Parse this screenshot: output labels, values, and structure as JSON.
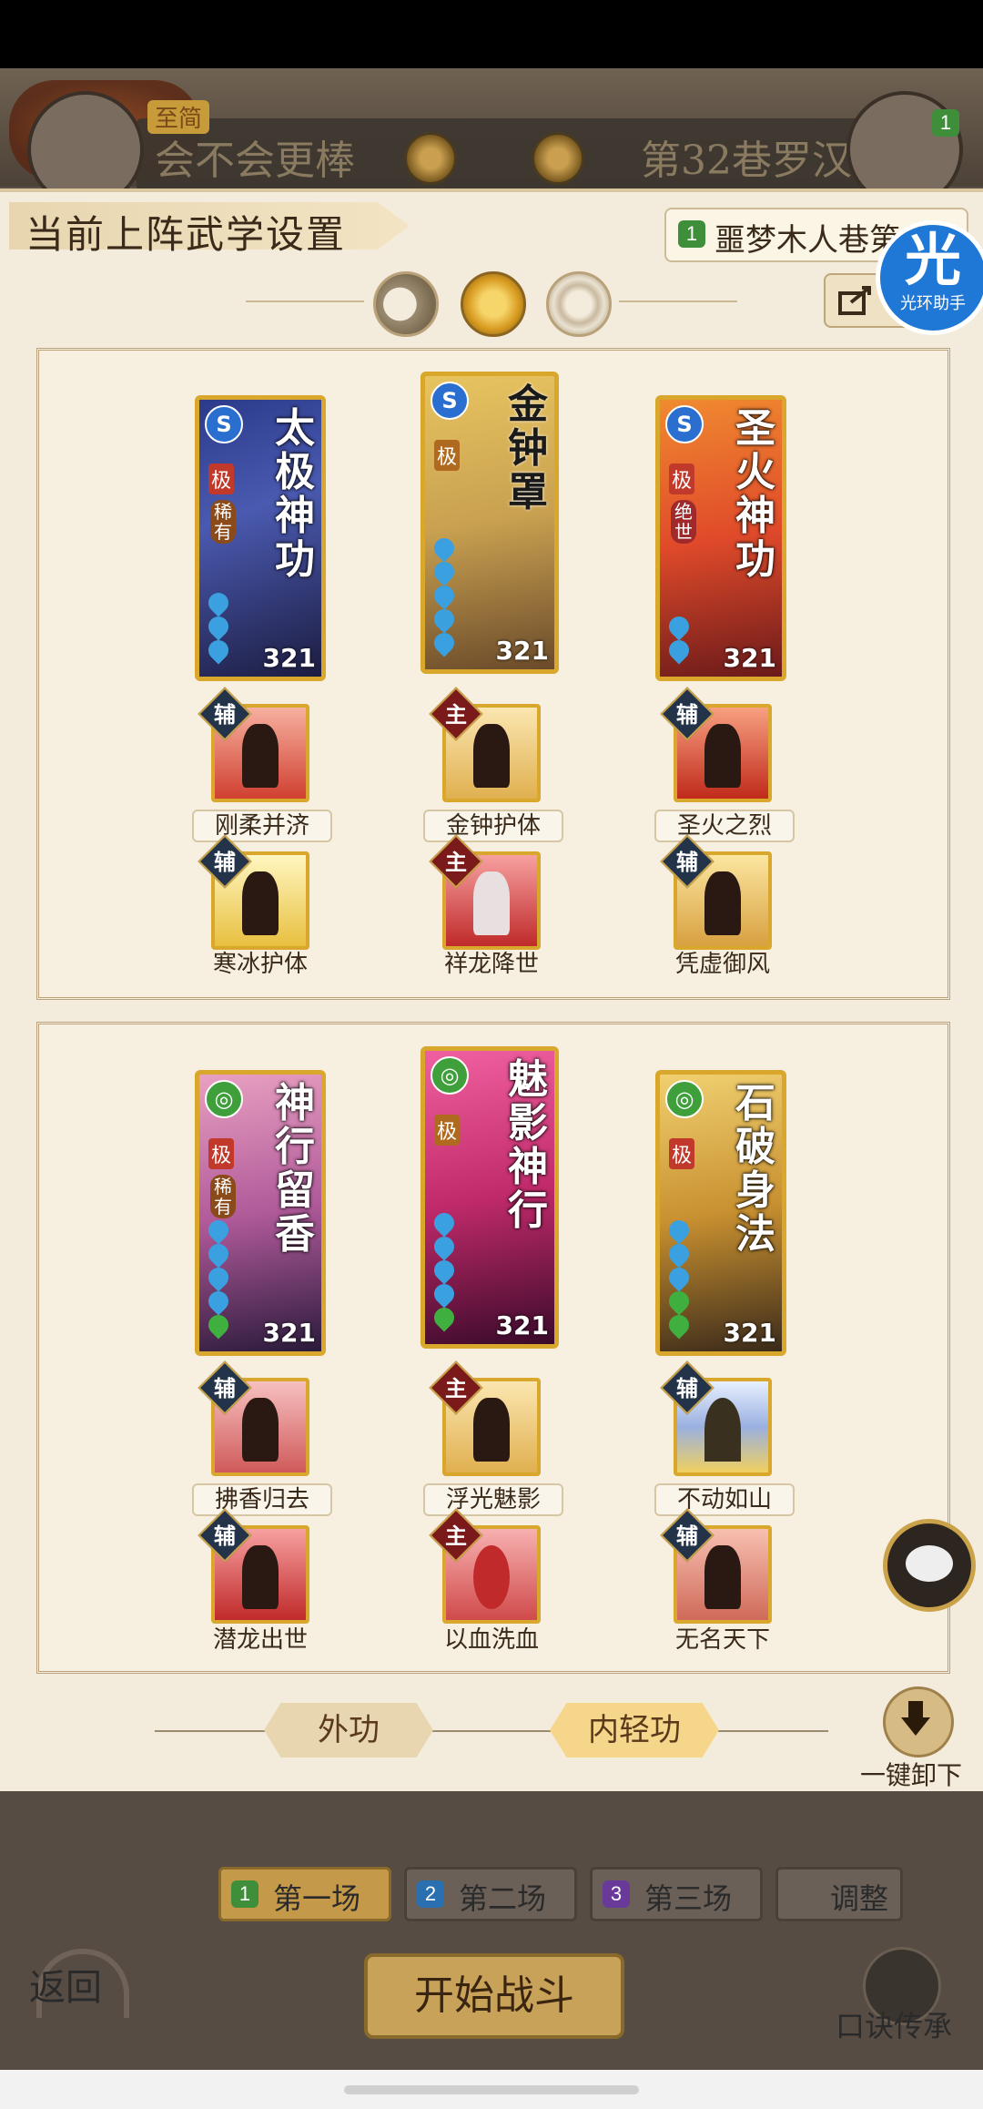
{
  "header": {
    "rank_badge": "至简",
    "left_team": "会不会更棒",
    "right_team": "第32巷罗汉",
    "right_level": "1"
  },
  "panel": {
    "title": "当前上阵武学设置",
    "team_select_num": "1",
    "team_select": "噩梦木人巷第",
    "helper_big": "光",
    "helper_small": "光环助手"
  },
  "section1": {
    "cards": [
      {
        "name": "太极神功",
        "score": "321",
        "rank": "极",
        "rarity": "稀有",
        "icon": "S"
      },
      {
        "name": "金钟罩",
        "score": "321",
        "rank": "极",
        "rarity": "",
        "icon": "S"
      },
      {
        "name": "圣火神功",
        "score": "321",
        "rank": "极",
        "rarity": "绝世",
        "icon": "S"
      }
    ],
    "skills_row1": [
      {
        "label": "刚柔并济",
        "mark": "辅"
      },
      {
        "label": "金钟护体",
        "mark": "主"
      },
      {
        "label": "圣火之烈",
        "mark": "辅"
      }
    ],
    "skills_row2": [
      {
        "label": "寒冰护体",
        "mark": "辅"
      },
      {
        "label": "祥龙降世",
        "mark": "主"
      },
      {
        "label": "凭虚御风",
        "mark": "辅"
      }
    ]
  },
  "section2": {
    "cards": [
      {
        "name": "神行留香",
        "score": "321",
        "rank": "极",
        "rarity": "稀有",
        "icon": "◎"
      },
      {
        "name": "魅影神行",
        "score": "321",
        "rank": "极",
        "rarity": "",
        "icon": "◎"
      },
      {
        "name": "石破身法",
        "score": "321",
        "rank": "极",
        "rarity": "",
        "icon": "◎"
      }
    ],
    "skills_row1": [
      {
        "label": "拂香归去",
        "mark": "辅"
      },
      {
        "label": "浮光魅影",
        "mark": "主"
      },
      {
        "label": "不动如山",
        "mark": "辅"
      }
    ],
    "skills_row2": [
      {
        "label": "潜龙出世",
        "mark": "辅"
      },
      {
        "label": "以血洗血",
        "mark": "主"
      },
      {
        "label": "无名天下",
        "mark": "辅"
      }
    ]
  },
  "tabs": {
    "outer": "外功",
    "inner": "内轻功"
  },
  "unload_label": "一键卸下",
  "matches": [
    {
      "num": "1",
      "label": "第一场",
      "color": "#3f8f3a"
    },
    {
      "num": "2",
      "label": "第二场",
      "color": "#2a6fb0"
    },
    {
      "num": "3",
      "label": "第三场",
      "color": "#6a3a9a"
    }
  ],
  "adjust_label": "调整",
  "start_label": "开始战斗",
  "back_label": "返回",
  "inherit_label": "口诀传承"
}
